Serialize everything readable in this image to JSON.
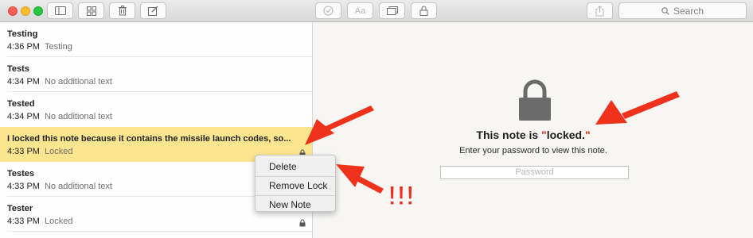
{
  "toolbar": {
    "search_label": "Search",
    "buttons": [
      "sidebar-toggle",
      "gallery-view",
      "delete",
      "compose",
      "checklist",
      "format-text",
      "media",
      "lock",
      "share"
    ]
  },
  "notes": [
    {
      "title": "Testing",
      "time": "4:36 PM",
      "preview": "Testing",
      "locked": false
    },
    {
      "title": "Tests",
      "time": "4:34 PM",
      "preview": "No additional text",
      "locked": false
    },
    {
      "title": "Tested",
      "time": "4:34 PM",
      "preview": "No additional text",
      "locked": false
    },
    {
      "title": "I locked this note because it contains the missile launch codes, so...",
      "time": "4:33 PM",
      "preview": "Locked",
      "locked": true,
      "selected": true
    },
    {
      "title": "Testes",
      "time": "4:33 PM",
      "preview": "No additional text",
      "locked": false
    },
    {
      "title": "Tester",
      "time": "4:33 PM",
      "preview": "Locked",
      "locked": true
    }
  ],
  "context_menu": {
    "items": [
      "Delete",
      "Remove Lock",
      "New Note"
    ]
  },
  "editor": {
    "title_pre": "This note is ",
    "open_quote": "\"",
    "title_word": "locked.",
    "close_quote": "\"",
    "subtitle": "Enter your password to view this note.",
    "password_placeholder": "Password"
  },
  "annotations": {
    "exclamation": "!!!",
    "arrow_color": "#f0321c"
  }
}
